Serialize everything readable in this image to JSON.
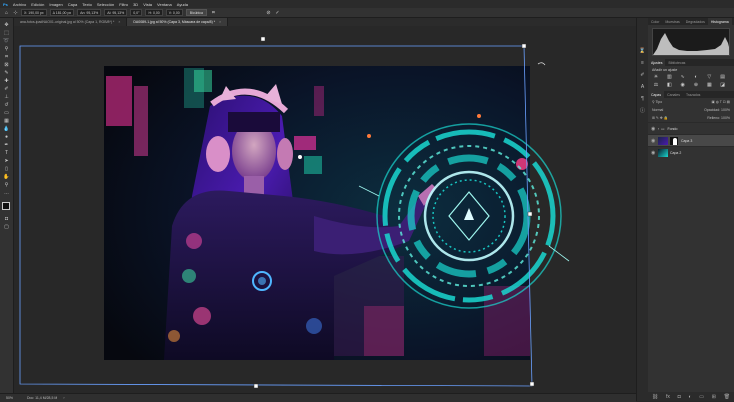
{
  "menu": [
    "Archivo",
    "Edición",
    "Imagen",
    "Capa",
    "Texto",
    "Selección",
    "Filtro",
    "3D",
    "Vista",
    "Ventana",
    "Ayuda"
  ],
  "options": {
    "fields": [
      "X: 190,00 px",
      "Δ 181,00 px",
      "An: 95,13%",
      "Al: 95,13%",
      "0,0°",
      "H: 0,00",
      "V: 0,00"
    ],
    "interpolation": "Bicúbica",
    "cancel_icon": "cancel-icon",
    "commit_icon": "checkmark-icon"
  },
  "tabs": [
    {
      "label": "ana-fotos-ipadNAO01-original.jpg al 50% (Capa 1, RGB/8*) *",
      "active": false
    },
    {
      "label": "DA0089-1.jpg al 50% (Capa 3, Máscara de capa/8) *",
      "active": true
    }
  ],
  "status": {
    "zoom": "50%",
    "doc": "Doc: 11,4 M/28,5 M"
  },
  "panels": {
    "top_tabs": [
      "Color",
      "Muestras",
      "Degradados",
      "Histograma"
    ],
    "adj_tabs": [
      "Ajustes",
      "Bibliotecas"
    ],
    "adj_title": "Añadir un ajuste",
    "layer_tabs": [
      "Capas",
      "Canales",
      "Trazados"
    ],
    "blend_mode": "Normal",
    "opacity_label": "Opacidad:",
    "opacity": "100%",
    "fill_label": "Relleno:",
    "fill": "100%",
    "layers": [
      {
        "name": "Fondo",
        "selected": false
      },
      {
        "name": "Capa 3",
        "selected": true
      },
      {
        "name": "Capa 2",
        "selected": false
      }
    ]
  },
  "colors": {
    "accent": "#1ad7d0",
    "magenta": "#e0309a",
    "purple": "#5a2bd6"
  }
}
